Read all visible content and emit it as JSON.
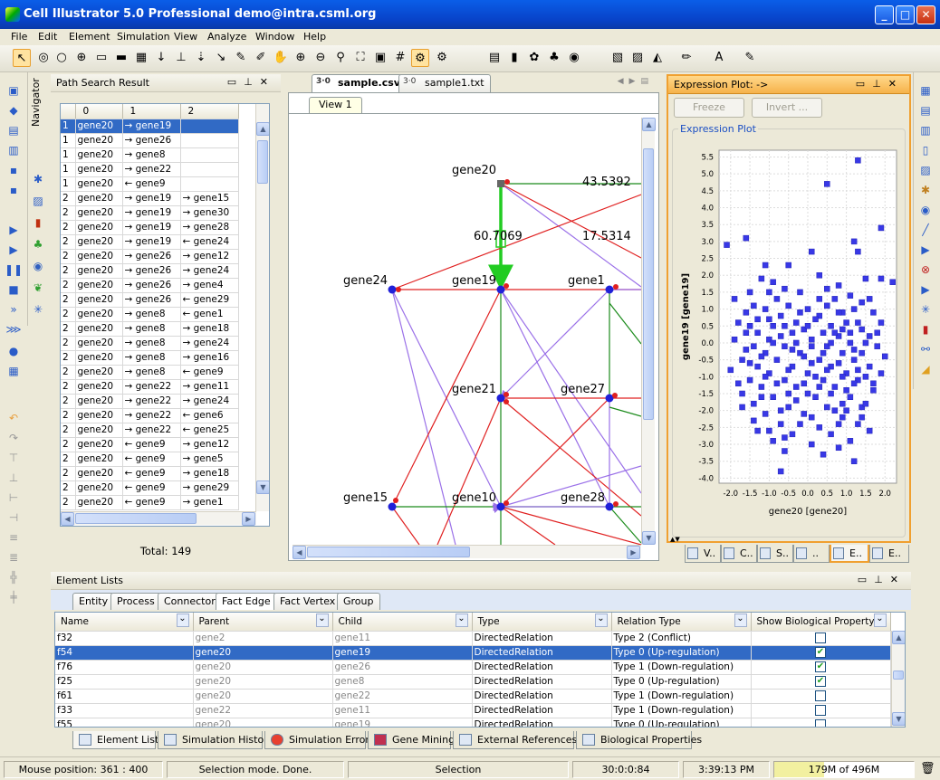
{
  "window": {
    "title": "Cell Illustrator 5.0 Professional demo@intra.csml.org",
    "min": "_",
    "max": "□",
    "close": "✕"
  },
  "menu": [
    "File",
    "Edit",
    "Element",
    "Simulation",
    "View",
    "Analyze",
    "Window",
    "Help"
  ],
  "sidebar": {
    "navigator_label": "Navigator"
  },
  "path_search": {
    "title": "Path Search Result",
    "columns": [
      "0",
      "1",
      "2"
    ],
    "rows": [
      [
        "1",
        "gene20",
        "→ gene19",
        ""
      ],
      [
        "1",
        "gene20",
        "→ gene26",
        ""
      ],
      [
        "1",
        "gene20",
        "→ gene8",
        ""
      ],
      [
        "1",
        "gene20",
        "→ gene22",
        ""
      ],
      [
        "1",
        "gene20",
        "← gene9",
        ""
      ],
      [
        "2",
        "gene20",
        "→ gene19",
        "→ gene15"
      ],
      [
        "2",
        "gene20",
        "→ gene19",
        "→ gene30"
      ],
      [
        "2",
        "gene20",
        "→ gene19",
        "→ gene28"
      ],
      [
        "2",
        "gene20",
        "→ gene19",
        "← gene24"
      ],
      [
        "2",
        "gene20",
        "→ gene26",
        "→ gene12"
      ],
      [
        "2",
        "gene20",
        "→ gene26",
        "→ gene24"
      ],
      [
        "2",
        "gene20",
        "→ gene26",
        "→ gene4"
      ],
      [
        "2",
        "gene20",
        "→ gene26",
        "← gene29"
      ],
      [
        "2",
        "gene20",
        "→ gene8",
        "← gene1"
      ],
      [
        "2",
        "gene20",
        "→ gene8",
        "→ gene18"
      ],
      [
        "2",
        "gene20",
        "→ gene8",
        "→ gene24"
      ],
      [
        "2",
        "gene20",
        "→ gene8",
        "→ gene16"
      ],
      [
        "2",
        "gene20",
        "→ gene8",
        "← gene9"
      ],
      [
        "2",
        "gene20",
        "→ gene22",
        "→ gene11"
      ],
      [
        "2",
        "gene20",
        "→ gene22",
        "→ gene24"
      ],
      [
        "2",
        "gene20",
        "→ gene22",
        "← gene6"
      ],
      [
        "2",
        "gene20",
        "→ gene22",
        "← gene25"
      ],
      [
        "2",
        "gene20",
        "← gene9",
        "→ gene12"
      ],
      [
        "2",
        "gene20",
        "← gene9",
        "→ gene5"
      ],
      [
        "2",
        "gene20",
        "← gene9",
        "→ gene18"
      ],
      [
        "2",
        "gene20",
        "← gene9",
        "→ gene29"
      ],
      [
        "2",
        "gene20",
        "← gene9",
        "→ gene1"
      ]
    ],
    "total": "Total: 149"
  },
  "canvas": {
    "tabs": [
      "sample.csv",
      "sample1.txt"
    ],
    "view_tab": "View 1",
    "nodes": {
      "gene20": "gene20",
      "gene24": "gene24",
      "gene19": "gene19",
      "gene1": "gene1",
      "gene21": "gene21",
      "gene27": "gene27",
      "gene15": "gene15",
      "gene10": "gene10",
      "gene28": "gene28"
    },
    "edge_labels": [
      "43.5392",
      "60.7069",
      "17.5314"
    ]
  },
  "expression_plot": {
    "title": "Expression Plot: ->",
    "freeze_label": "Freeze",
    "invert_label": "Invert ...",
    "section_label": "Expression Plot",
    "bottom_tabs": [
      "V..",
      "C..",
      "S..",
      "..",
      "E..",
      "E.."
    ]
  },
  "chart_data": {
    "type": "scatter",
    "xlabel": "gene20 [gene20]",
    "ylabel": "gene19 [gene19]",
    "xlim": [
      -2.3,
      2.3
    ],
    "ylim": [
      -4.15,
      5.7
    ],
    "x_ticks": [
      "-2.0",
      "-1.5",
      "-1.0",
      "-0.5",
      "0.0",
      "0.5",
      "1.0",
      "1.5",
      "2.0"
    ],
    "y_ticks": [
      "5.5",
      "5.0",
      "4.5",
      "4.0",
      "3.5",
      "3.0",
      "2.5",
      "2.0",
      "1.5",
      "1.0",
      "0.5",
      "0.0",
      "-0.5",
      "-1.0",
      "-1.5",
      "-2.0",
      "-2.5",
      "-3.0",
      "-3.5",
      "-4.0"
    ],
    "grid": true,
    "color": "#3838e6",
    "points": [
      [
        1.3,
        5.4
      ],
      [
        0.5,
        4.7
      ],
      [
        -1.6,
        3.1
      ],
      [
        1.9,
        3.4
      ],
      [
        -2.1,
        2.9
      ],
      [
        1.2,
        3.0
      ],
      [
        1.3,
        2.7
      ],
      [
        0.1,
        2.7
      ],
      [
        -0.5,
        2.3
      ],
      [
        -1.1,
        2.3
      ],
      [
        0.3,
        2.0
      ],
      [
        -1.2,
        1.9
      ],
      [
        1.5,
        1.9
      ],
      [
        1.9,
        1.9
      ],
      [
        0.8,
        1.7
      ],
      [
        2.2,
        1.8
      ],
      [
        -1.0,
        1.5
      ],
      [
        0.5,
        1.6
      ],
      [
        -1.5,
        1.5
      ],
      [
        1.4,
        1.2
      ],
      [
        -1.9,
        1.3
      ],
      [
        -0.5,
        1.1
      ],
      [
        1.2,
        1.0
      ],
      [
        -0.2,
        0.9
      ],
      [
        0.9,
        0.9
      ],
      [
        -0.7,
        0.8
      ],
      [
        0.3,
        0.8
      ],
      [
        -1.3,
        0.7
      ],
      [
        1.0,
        0.6
      ],
      [
        1.9,
        0.6
      ],
      [
        -0.9,
        0.5
      ],
      [
        0.6,
        0.5
      ],
      [
        -0.1,
        0.4
      ],
      [
        1.4,
        0.4
      ],
      [
        -1.6,
        0.3
      ],
      [
        -0.4,
        0.3
      ],
      [
        0.8,
        0.2
      ],
      [
        1.6,
        0.2
      ],
      [
        -1.0,
        0.1
      ],
      [
        0.1,
        0.1
      ],
      [
        1.1,
        0.0
      ],
      [
        -1.4,
        -0.1
      ],
      [
        -0.6,
        -0.1
      ],
      [
        0.5,
        -0.1
      ],
      [
        1.8,
        -0.1
      ],
      [
        -1.1,
        -0.3
      ],
      [
        -0.2,
        -0.3
      ],
      [
        0.9,
        -0.3
      ],
      [
        1.4,
        -0.3
      ],
      [
        -1.7,
        -0.5
      ],
      [
        -0.8,
        -0.5
      ],
      [
        0.3,
        -0.5
      ],
      [
        1.2,
        -0.5
      ],
      [
        -1.3,
        -0.7
      ],
      [
        -0.4,
        -0.7
      ],
      [
        0.6,
        -0.7
      ],
      [
        1.6,
        -0.7
      ],
      [
        -1.0,
        -0.9
      ],
      [
        0.0,
        -0.9
      ],
      [
        1.0,
        -0.9
      ],
      [
        -1.5,
        -1.1
      ],
      [
        -0.6,
        -1.1
      ],
      [
        0.4,
        -1.1
      ],
      [
        1.3,
        -1.1
      ],
      [
        -1.2,
        -1.3
      ],
      [
        -0.3,
        -1.3
      ],
      [
        0.7,
        -1.3
      ],
      [
        1.7,
        -1.4
      ],
      [
        -1.7,
        -1.5
      ],
      [
        -0.9,
        -1.6
      ],
      [
        0.2,
        -1.6
      ],
      [
        1.1,
        -1.6
      ],
      [
        -1.4,
        -1.8
      ],
      [
        -0.5,
        -1.9
      ],
      [
        0.5,
        -1.9
      ],
      [
        1.4,
        -1.9
      ],
      [
        -1.1,
        -2.1
      ],
      [
        -0.1,
        -2.1
      ],
      [
        0.9,
        -2.2
      ],
      [
        -0.7,
        -2.4
      ],
      [
        0.3,
        -2.5
      ],
      [
        1.3,
        -2.4
      ],
      [
        -1.3,
        -2.6
      ],
      [
        -0.4,
        -2.7
      ],
      [
        0.6,
        -2.7
      ],
      [
        1.6,
        -2.6
      ],
      [
        -0.9,
        -2.9
      ],
      [
        0.1,
        -3.0
      ],
      [
        1.1,
        -2.9
      ],
      [
        -0.6,
        -3.2
      ],
      [
        0.4,
        -3.3
      ],
      [
        1.2,
        -3.5
      ],
      [
        -0.7,
        -3.8
      ],
      [
        -0.6,
        -2.8
      ],
      [
        0.8,
        -3.1
      ],
      [
        -2.0,
        -0.8
      ],
      [
        -1.8,
        -1.2
      ],
      [
        2.0,
        -0.4
      ],
      [
        -0.3,
        0.6
      ],
      [
        0.7,
        1.3
      ],
      [
        -1.6,
        0.9
      ],
      [
        0.1,
        -0.6
      ],
      [
        1.5,
        -1.8
      ],
      [
        -0.8,
        1.3
      ],
      [
        0.4,
        0.3
      ],
      [
        -1.2,
        -0.4
      ],
      [
        0.0,
        1.0
      ],
      [
        1.7,
        0.9
      ],
      [
        -0.5,
        -1.5
      ],
      [
        0.9,
        0.4
      ],
      [
        -1.9,
        0.1
      ],
      [
        0.6,
        -1.5
      ],
      [
        -0.2,
        -2.4
      ],
      [
        1.0,
        -2.0
      ],
      [
        -1.4,
        -2.3
      ],
      [
        0.2,
        -1.0
      ],
      [
        1.8,
        0.3
      ],
      [
        -0.9,
        0.0
      ],
      [
        0.5,
        1.1
      ],
      [
        -0.1,
        -0.4
      ],
      [
        1.3,
        0.6
      ],
      [
        -1.1,
        1.0
      ],
      [
        0.8,
        -0.6
      ],
      [
        -0.7,
        0.2
      ],
      [
        1.5,
        -1.0
      ],
      [
        -1.5,
        -0.6
      ],
      [
        0.0,
        0.5
      ],
      [
        -0.3,
        -1.7
      ],
      [
        1.1,
        1.4
      ],
      [
        -1.0,
        -2.6
      ],
      [
        0.7,
        -2.0
      ],
      [
        -0.6,
        0.5
      ],
      [
        1.9,
        -0.9
      ],
      [
        -1.8,
        0.6
      ],
      [
        0.3,
        1.3
      ],
      [
        -0.4,
        -0.2
      ],
      [
        0.9,
        -1.0
      ],
      [
        -1.3,
        0.3
      ],
      [
        1.2,
        -0.2
      ],
      [
        -0.8,
        -1.2
      ],
      [
        0.1,
        -2.2
      ],
      [
        1.6,
        1.3
      ],
      [
        -1.6,
        -0.2
      ],
      [
        0.6,
        0.0
      ],
      [
        -0.2,
        1.5
      ],
      [
        1.0,
        -1.4
      ],
      [
        -1.0,
        0.7
      ],
      [
        0.4,
        -0.3
      ],
      [
        1.4,
        -2.2
      ],
      [
        -0.5,
        -0.8
      ],
      [
        0.8,
        0.9
      ],
      [
        -1.2,
        -1.6
      ],
      [
        0.2,
        0.7
      ],
      [
        1.7,
        -1.2
      ],
      [
        -0.9,
        1.8
      ],
      [
        -0.1,
        -1.2
      ],
      [
        1.1,
        0.3
      ],
      [
        -1.4,
        1.1
      ],
      [
        0.5,
        -0.8
      ],
      [
        -0.7,
        -2.0
      ],
      [
        1.3,
        -0.8
      ],
      [
        -1.7,
        -1.9
      ],
      [
        0.1,
        -0.1
      ],
      [
        0.9,
        -1.8
      ],
      [
        -0.3,
        0.0
      ],
      [
        1.5,
        0.0
      ],
      [
        -1.1,
        -1.0
      ],
      [
        0.7,
        0.3
      ],
      [
        -0.6,
        1.6
      ],
      [
        0.3,
        -1.3
      ],
      [
        1.2,
        -1.2
      ],
      [
        -1.5,
        0.5
      ],
      [
        0.0,
        -1.5
      ],
      [
        0.8,
        -2.4
      ]
    ]
  },
  "element_lists": {
    "title": "Element Lists",
    "tabs": [
      "Entity",
      "Process",
      "Connector",
      "Fact Edge",
      "Fact Vertex",
      "Group"
    ],
    "columns": [
      "Name",
      "Parent",
      "Child",
      "Type",
      "Relation Type",
      "Show Biological Property"
    ],
    "rows": [
      [
        "f32",
        "gene2",
        "gene11",
        "DirectedRelation",
        "Type 2 (Conflict)",
        false
      ],
      [
        "f54",
        "gene20",
        "gene19",
        "DirectedRelation",
        "Type 0 (Up-regulation)",
        true
      ],
      [
        "f76",
        "gene20",
        "gene26",
        "DirectedRelation",
        "Type 1 (Down-regulation)",
        true
      ],
      [
        "f25",
        "gene20",
        "gene8",
        "DirectedRelation",
        "Type 0 (Up-regulation)",
        true
      ],
      [
        "f61",
        "gene20",
        "gene22",
        "DirectedRelation",
        "Type 1 (Down-regulation)",
        false
      ],
      [
        "f33",
        "gene22",
        "gene11",
        "DirectedRelation",
        "Type 1 (Down-regulation)",
        false
      ],
      [
        "f55",
        "gene20",
        "gene19",
        "DirectedRelation",
        "Type 0 (Up-regulation)",
        false
      ]
    ],
    "bottom_tabs": [
      "Element Lists",
      "Simulation History",
      "Simulation Errors",
      "Gene Mining",
      "External References",
      "Biological Properties"
    ]
  },
  "status": {
    "mouse": "Mouse position: 361 : 400",
    "mode": "Selection mode.   Done.",
    "selection": "Selection",
    "time": "30:0:0:84",
    "clock": "3:39:13 PM",
    "memory": "179M of 496M",
    "memory_fraction": 0.36
  }
}
